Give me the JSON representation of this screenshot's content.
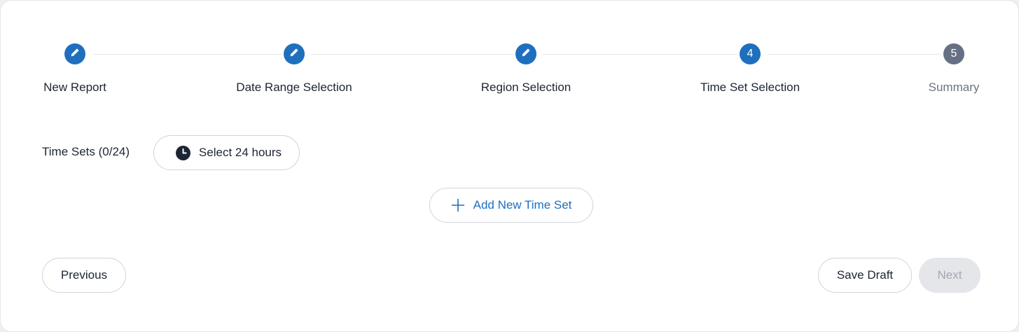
{
  "stepper": {
    "steps": [
      {
        "label": "New Report",
        "status": "completed",
        "icon": "pencil-icon"
      },
      {
        "label": "Date Range Selection",
        "status": "completed",
        "icon": "pencil-icon"
      },
      {
        "label": "Region Selection",
        "status": "completed",
        "icon": "pencil-icon"
      },
      {
        "label": "Time Set Selection",
        "status": "active",
        "number": "4"
      },
      {
        "label": "Summary",
        "status": "pending",
        "number": "5"
      }
    ]
  },
  "time_sets": {
    "label": "Time Sets (0/24)",
    "select_all_label": "Select 24 hours",
    "select_all_icon": "clock-icon",
    "add_label": "Add New Time Set",
    "add_icon": "plus-icon"
  },
  "footer": {
    "previous_label": "Previous",
    "save_draft_label": "Save Draft",
    "next_label": "Next",
    "next_disabled": true
  },
  "colors": {
    "accent": "#1f6fbf",
    "pending_step": "#667085",
    "text": "#1d2433",
    "muted_text": "#6b7480",
    "disabled_bg": "#e4e6e9",
    "disabled_text": "#a2a9b3"
  }
}
